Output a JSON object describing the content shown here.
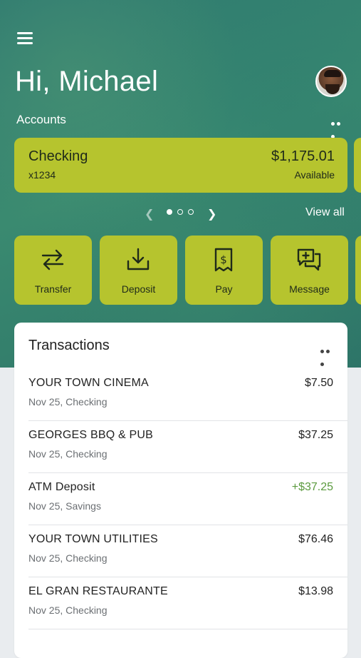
{
  "header": {
    "greeting": "Hi, Michael",
    "accounts_label": "Accounts",
    "view_all": "View all"
  },
  "account": {
    "name": "Checking",
    "number": "x1234",
    "balance": "$1,175.01",
    "balance_label": "Available"
  },
  "pager": {
    "total": 3,
    "active": 1
  },
  "actions": [
    {
      "label": "Transfer",
      "icon": "transfer-icon"
    },
    {
      "label": "Deposit",
      "icon": "deposit-icon"
    },
    {
      "label": "Pay",
      "icon": "pay-icon"
    },
    {
      "label": "Message",
      "icon": "message-icon"
    }
  ],
  "transactions": {
    "title": "Transactions",
    "items": [
      {
        "name": "YOUR TOWN CINEMA",
        "sub": "Nov 25, Checking",
        "amount": "$7.50",
        "credit": false
      },
      {
        "name": "GEORGES BBQ & PUB",
        "sub": "Nov 25, Checking",
        "amount": "$37.25",
        "credit": false
      },
      {
        "name": "ATM Deposit",
        "sub": "Nov 25, Savings",
        "amount": "+$37.25",
        "credit": true
      },
      {
        "name": "YOUR TOWN UTILITIES",
        "sub": "Nov 25, Checking",
        "amount": "$76.46",
        "credit": false
      },
      {
        "name": "EL GRAN RESTAURANTE",
        "sub": "Nov 25, Checking",
        "amount": "$13.98",
        "credit": false
      }
    ]
  },
  "colors": {
    "accent": "#b6c42e",
    "hero": "#2f7a70",
    "credit": "#5b9a3e"
  }
}
